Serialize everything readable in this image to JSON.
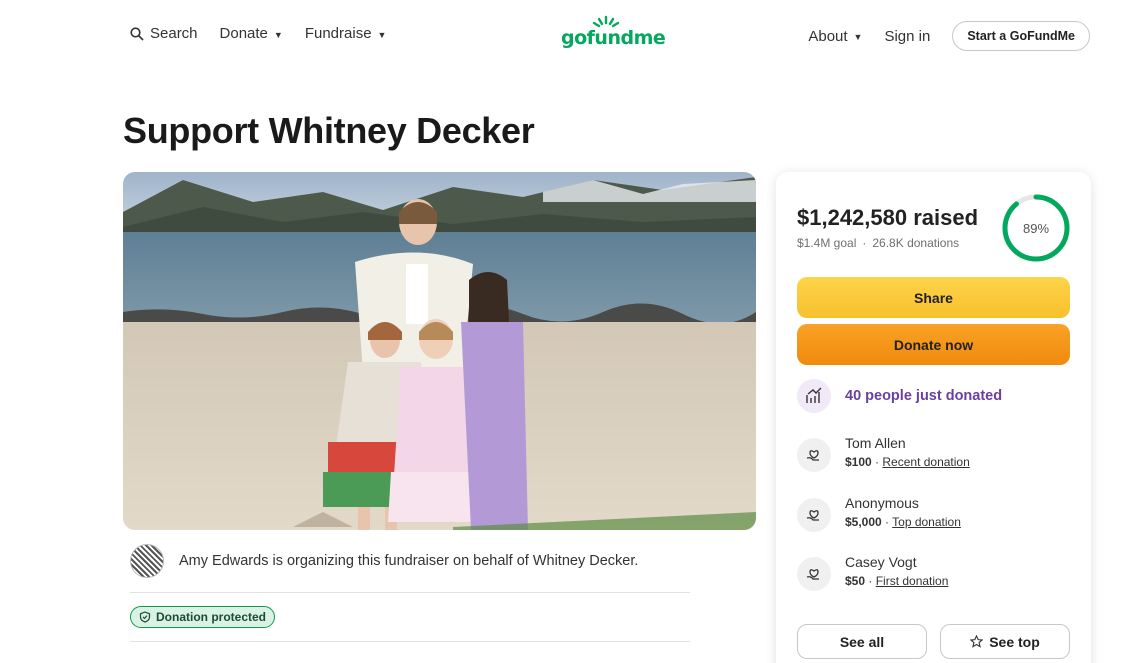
{
  "header": {
    "search_label": "Search",
    "donate_label": "Donate",
    "fundraise_label": "Fundraise",
    "logo_text": "gofundme",
    "about_label": "About",
    "signin_label": "Sign in",
    "start_label": "Start a GoFundMe"
  },
  "page": {
    "title": "Support Whitney Decker"
  },
  "organizer": {
    "text": "Amy Edwards is organizing this fundraiser on behalf of Whitney Decker.",
    "protected_label": "Donation protected"
  },
  "sidebar": {
    "raised": "$1,242,580 raised",
    "goal": "$1.4M goal",
    "donations": "26.8K donations",
    "progress_percent": 89,
    "progress_label": "89%",
    "share_label": "Share",
    "donate_now_label": "Donate now",
    "recent_activity": "40 people just donated",
    "donors": [
      {
        "name": "Tom Allen",
        "amount": "$100",
        "tag": "Recent donation"
      },
      {
        "name": "Anonymous",
        "amount": "$5,000",
        "tag": "Top donation"
      },
      {
        "name": "Casey Vogt",
        "amount": "$50",
        "tag": "First donation"
      }
    ],
    "see_all_label": "See all",
    "see_top_label": "See top"
  },
  "colors": {
    "brand_green": "#02a95c",
    "share_yellow": "#f7c02d",
    "donate_orange": "#f08a0c",
    "activity_purple": "#6b3fa0"
  }
}
